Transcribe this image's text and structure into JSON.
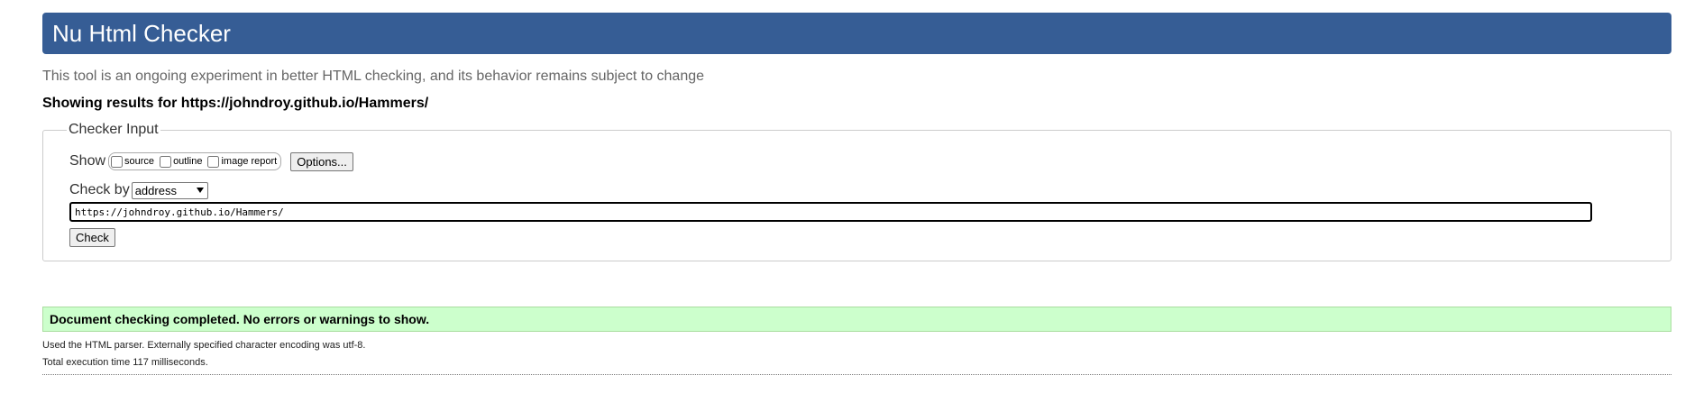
{
  "header": {
    "title": "Nu Html Checker"
  },
  "intro": {
    "subtitle": "This tool is an ongoing experiment in better HTML checking, and its behavior remains subject to change",
    "results_for": "Showing results for https://johndroy.github.io/Hammers/"
  },
  "checker_input": {
    "legend": "Checker Input",
    "show_label": "Show",
    "show_options": [
      {
        "label": "source",
        "checked": false
      },
      {
        "label": "outline",
        "checked": false
      },
      {
        "label": "image report",
        "checked": false
      }
    ],
    "options_button": "Options...",
    "check_by_label": "Check by",
    "check_by_selected": "address",
    "url_value": "https://johndroy.github.io/Hammers/",
    "check_button": "Check"
  },
  "result": {
    "status": "Document checking completed. No errors or warnings to show.",
    "status_color": "#CCFFCC",
    "parser_line": "Used the HTML parser. Externally specified character encoding was utf-8.",
    "time_line": "Total execution time 117 milliseconds."
  },
  "colors": {
    "title_bar": "#365D95",
    "subtitle": "#666666"
  }
}
